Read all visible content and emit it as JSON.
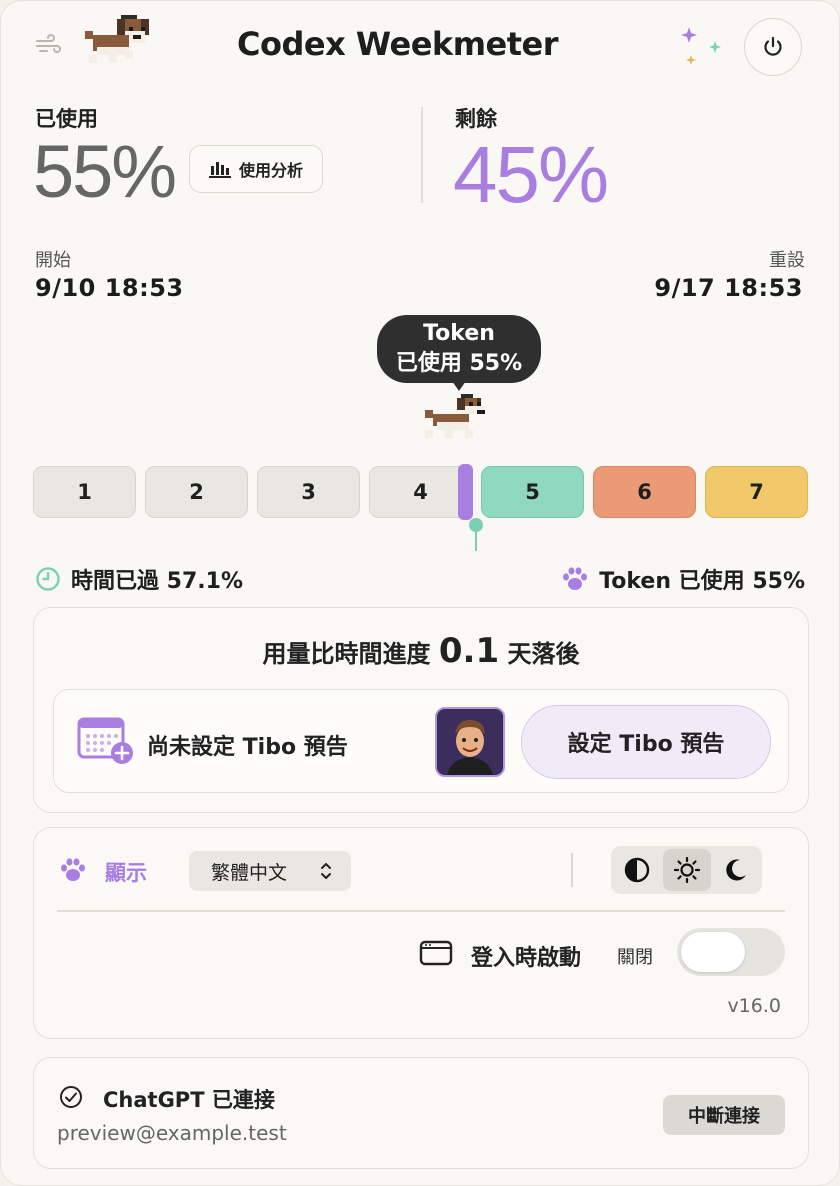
{
  "header": {
    "title": "Codex Weekmeter"
  },
  "usage": {
    "used_label": "已使用",
    "used_value": "55%",
    "analysis_button": "使用分析",
    "remaining_label": "剩餘",
    "remaining_value": "45%"
  },
  "period": {
    "start_label": "開始",
    "start_date": "9/10 18:53",
    "reset_label": "重設",
    "reset_date": "9/17 18:53"
  },
  "tooltip": {
    "line1": "Token",
    "line2": "已使用 55%"
  },
  "days": [
    {
      "label": "1",
      "color": "#e8e7e2"
    },
    {
      "label": "2",
      "color": "#e8e7e2"
    },
    {
      "label": "3",
      "color": "#e8e7e2"
    },
    {
      "label": "4",
      "color": "#e8e7e2"
    },
    {
      "label": "5",
      "color": "#8fd9c0"
    },
    {
      "label": "6",
      "color": "#eb9a76"
    },
    {
      "label": "7",
      "color": "#f2c96a"
    }
  ],
  "stats": {
    "time_elapsed": "時間已過 57.1%",
    "token_used": "Token 已使用 55%"
  },
  "progress": {
    "prefix": "用量比時間進度",
    "value": "0.1",
    "suffix": "天落後"
  },
  "forecast": {
    "status": "尚未設定 Tibo 預告",
    "button": "設定 Tibo 預告"
  },
  "settings": {
    "display_label": "顯示",
    "language": "繁體中文",
    "launch_label": "登入時啟動",
    "launch_state": "關閉",
    "version": "v16.0"
  },
  "account": {
    "status": "ChatGPT 已連接",
    "email": "preview@example.test",
    "disconnect": "中斷連接"
  },
  "colors": {
    "accent": "#a87ee0",
    "teal": "#7ccfb4"
  }
}
